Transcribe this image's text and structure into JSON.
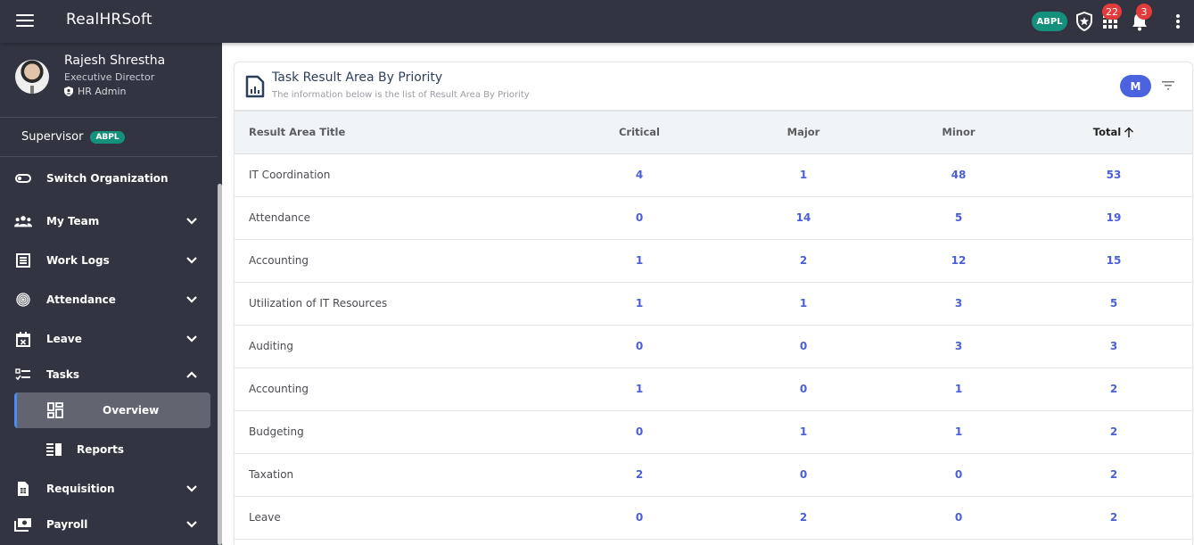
{
  "app": {
    "brand": "RealHRSoft",
    "org_badge": "ABPL",
    "apps_badge_count": "22",
    "notifications_badge_count": "3"
  },
  "profile": {
    "name": "Rajesh Shrestha",
    "designation": "Executive Director",
    "role": "HR Admin"
  },
  "supervisor": {
    "label": "Supervisor",
    "badge": "ABPL"
  },
  "sidebar": {
    "items": [
      {
        "label": "Switch Organization",
        "icon": "toggle-icon"
      },
      {
        "label": "My Team",
        "icon": "team-icon"
      },
      {
        "label": "Work Logs",
        "icon": "worklog-icon"
      },
      {
        "label": "Attendance",
        "icon": "fingerprint-icon"
      },
      {
        "label": "Leave",
        "icon": "calendar-x-icon"
      },
      {
        "label": "Tasks",
        "icon": "checklist-icon"
      },
      {
        "label": "Requisition",
        "icon": "document-icon"
      },
      {
        "label": "Payroll",
        "icon": "money-icon"
      }
    ],
    "tasks_sub": [
      {
        "label": "Overview",
        "icon": "dashboard-icon",
        "active": true
      },
      {
        "label": "Reports",
        "icon": "report-icon",
        "active": false
      }
    ]
  },
  "card": {
    "title": "Task Result Area By Priority",
    "subtitle": "The information below is the list of Result Area By Priority",
    "m_button": "M"
  },
  "table": {
    "columns": [
      "Result Area Title",
      "Critical",
      "Major",
      "Minor",
      "Total"
    ],
    "sorted_by": "Total",
    "sort_direction": "ascending",
    "rows": [
      {
        "title": "IT Coordination",
        "critical": "4",
        "major": "1",
        "minor": "48",
        "total": "53"
      },
      {
        "title": "Attendance",
        "critical": "0",
        "major": "14",
        "minor": "5",
        "total": "19"
      },
      {
        "title": "Accounting",
        "critical": "1",
        "major": "2",
        "minor": "12",
        "total": "15"
      },
      {
        "title": "Utilization of IT Resources",
        "critical": "1",
        "major": "1",
        "minor": "3",
        "total": "5"
      },
      {
        "title": "Auditing",
        "critical": "0",
        "major": "0",
        "minor": "3",
        "total": "3"
      },
      {
        "title": "Accounting",
        "critical": "1",
        "major": "0",
        "minor": "1",
        "total": "2"
      },
      {
        "title": "Budgeting",
        "critical": "0",
        "major": "1",
        "minor": "1",
        "total": "2"
      },
      {
        "title": "Taxation",
        "critical": "2",
        "major": "0",
        "minor": "0",
        "total": "2"
      },
      {
        "title": "Leave",
        "critical": "0",
        "major": "2",
        "minor": "0",
        "total": "2"
      }
    ]
  },
  "colors": {
    "topbar": "#323441",
    "accent_teal": "#15907d",
    "value_blue": "#4b5fd6",
    "badge_red": "#e33b3b",
    "active_indicator": "#4a8bf5"
  }
}
